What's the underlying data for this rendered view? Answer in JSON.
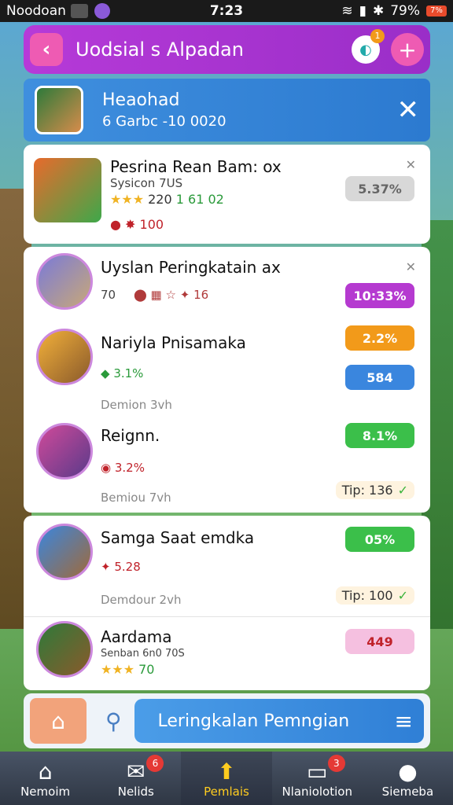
{
  "status_bar": {
    "carrier": "Noodoan",
    "time": "7:23",
    "battery": "79%",
    "battery_icon": "7%"
  },
  "header": {
    "back_icon": "‹",
    "title": "Uodsial ѕ Alpadan",
    "chat_badge": "1",
    "plus_icon": "+"
  },
  "user": {
    "name": "Heaohad",
    "sub": "6 Garbc -10 0020"
  },
  "feature": {
    "name": "Pesrina Rean Bam:  ox",
    "system": "Sysicon 7US",
    "rating": "★★★",
    "score": "220",
    "score_b": "1 61 02",
    "gem": "100",
    "pill": "5.37%"
  },
  "list1": [
    {
      "name": "Uyslan Peringkatain  ax",
      "rank": "70",
      "reward": "16",
      "pill": "10:33%",
      "pill_color": "#b53ad0"
    },
    {
      "name": "Nariyla Pnisamaka",
      "points": "3.1%",
      "pill": "2.2%",
      "pill_color": "#f29a1a",
      "pill2": "584",
      "pill2_color": "#3a86de"
    },
    {
      "name": "Reignn.",
      "meta": "Demion  3vh",
      "points": "3.2%",
      "pill": "8.1%",
      "pill_color": "#3bbf4a",
      "meta2": "Bemiou  7vh",
      "tip": "Tip: 136"
    }
  ],
  "list2": [
    {
      "name": "Samga Saat   emdka",
      "points": "5.28",
      "pill": "05%",
      "pill_color": "#3bbf4a",
      "meta": "Demdour  2vh",
      "tip": "Tip: 100"
    },
    {
      "name": "Aardama",
      "system": "Senban 6n0 70S",
      "rating": "★★★",
      "score": "70",
      "pill": "449",
      "pill_color": "#f5c0e0"
    }
  ],
  "action": {
    "main": "Leringkalan Pemngian"
  },
  "nav": [
    {
      "label": "Nemoim",
      "icon": "⌂",
      "badge": ""
    },
    {
      "label": "Nelids",
      "icon": "✉",
      "badge": "6"
    },
    {
      "label": "Pemlais",
      "icon": "⬆",
      "badge": ""
    },
    {
      "label": "Nlaniolotion",
      "icon": "▭",
      "badge": "3"
    },
    {
      "label": "Siemeba",
      "icon": "●",
      "badge": ""
    }
  ]
}
